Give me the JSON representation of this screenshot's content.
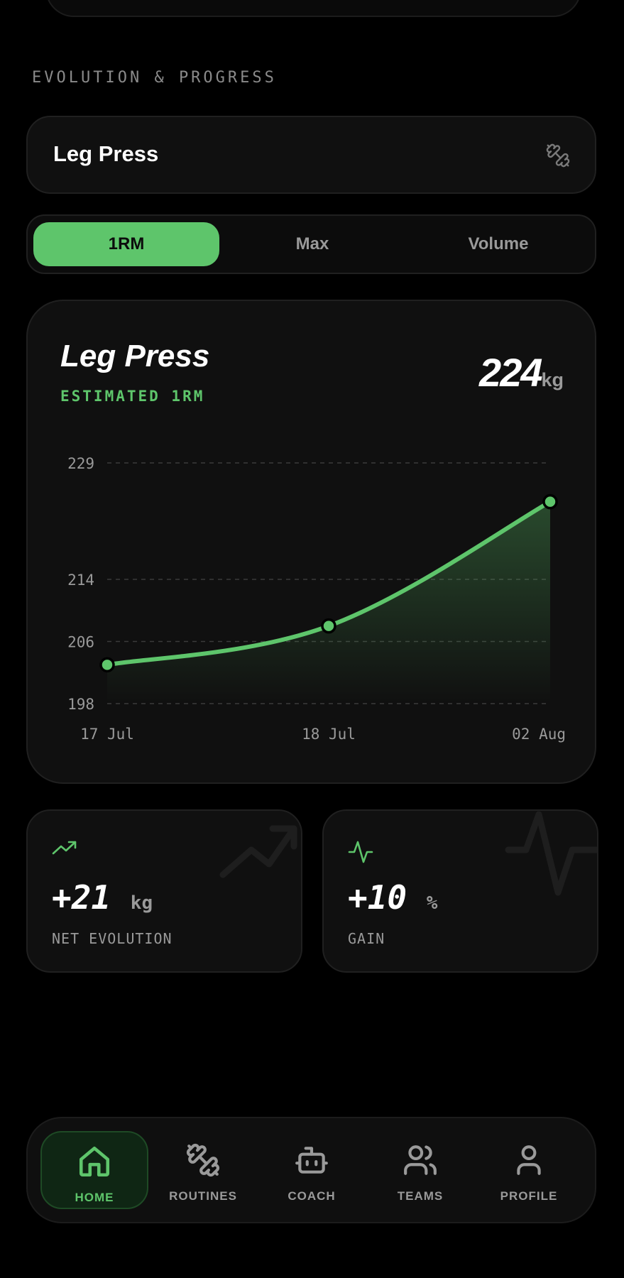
{
  "section": {
    "title": "EVOLUTION & PROGRESS"
  },
  "exercise_selector": {
    "name": "Leg Press",
    "icon": "dumbbell-icon"
  },
  "tabs": [
    {
      "label": "1RM",
      "active": true
    },
    {
      "label": "Max",
      "active": false
    },
    {
      "label": "Volume",
      "active": false
    }
  ],
  "chart_card": {
    "title": "Leg Press",
    "subtitle": "ESTIMATED 1RM",
    "current_value": "224",
    "current_unit": "kg"
  },
  "chart_data": {
    "type": "area",
    "x": [
      "17 Jul",
      "18 Jul",
      "02 Aug"
    ],
    "y": [
      203,
      208,
      224
    ],
    "y_ticks": [
      198,
      206,
      214,
      229
    ],
    "ylim": [
      198,
      229
    ],
    "grid": true,
    "accent_color": "#5ec56b"
  },
  "stats": [
    {
      "value": "+21",
      "unit": "kg",
      "label": "NET EVOLUTION",
      "icon": "trending-up-icon"
    },
    {
      "value": "+10",
      "unit": "%",
      "label": "GAIN",
      "icon": "activity-icon"
    }
  ],
  "nav": [
    {
      "label": "HOME",
      "icon": "home-icon",
      "active": true
    },
    {
      "label": "ROUTINES",
      "icon": "dumbbell-icon",
      "active": false
    },
    {
      "label": "COACH",
      "icon": "robot-icon",
      "active": false
    },
    {
      "label": "TEAMS",
      "icon": "users-icon",
      "active": false
    },
    {
      "label": "PROFILE",
      "icon": "user-icon",
      "active": false
    }
  ],
  "colors": {
    "accent": "#5ec56b",
    "background": "#000000",
    "card": "#101010",
    "muted": "#9a9a9a"
  }
}
